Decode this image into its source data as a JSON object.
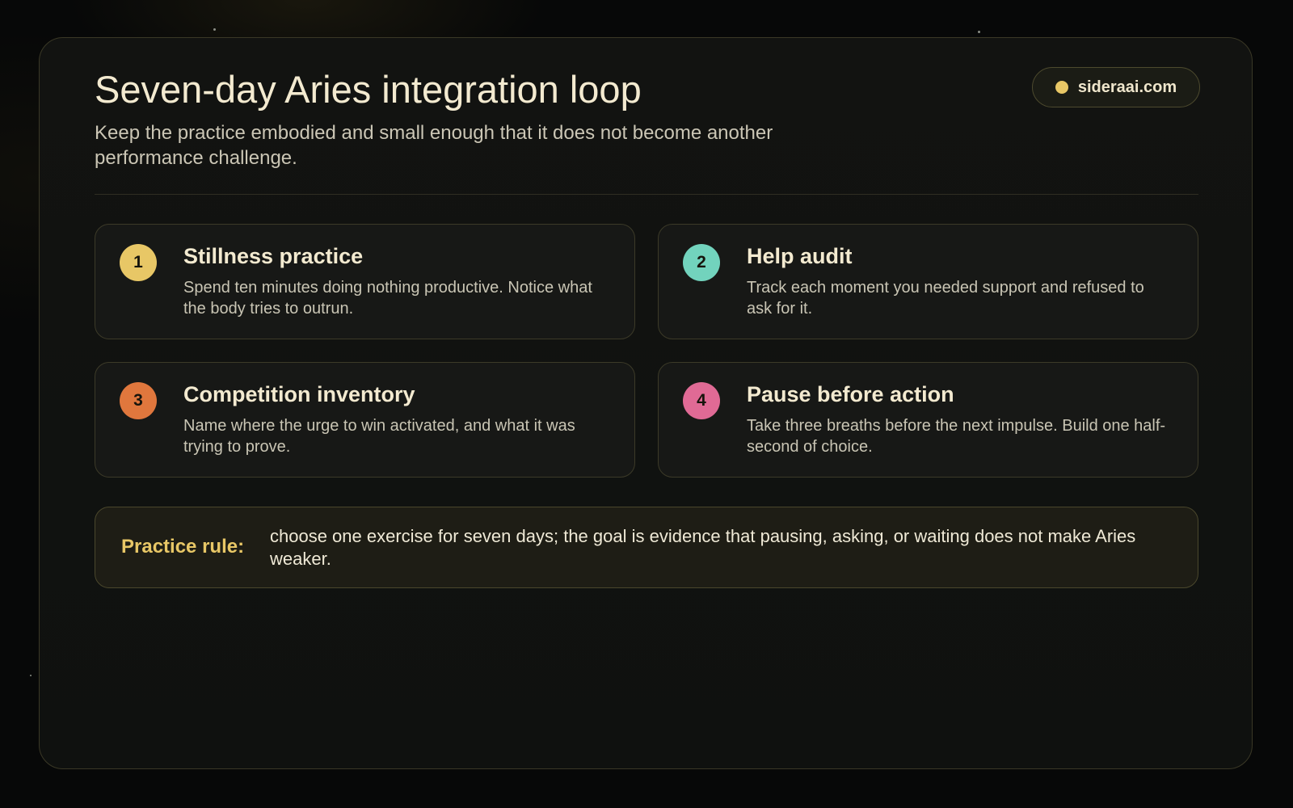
{
  "header": {
    "title": "Seven-day Aries integration loop",
    "subtitle": "Keep the practice embodied and small enough that it does not become another performance challenge."
  },
  "site_badge": {
    "label": "sideraai.com",
    "dot_color": "#e8c766"
  },
  "steps": [
    {
      "number": "1",
      "title": "Stillness practice",
      "description": "Spend ten minutes doing nothing productive. Notice what the body tries to outrun.",
      "color": "#e8c766"
    },
    {
      "number": "2",
      "title": "Help audit",
      "description": "Track each moment you needed support and refused to ask for it.",
      "color": "#72d3bd"
    },
    {
      "number": "3",
      "title": "Competition inventory",
      "description": "Name where the urge to win activated, and what it was trying to prove.",
      "color": "#e0773d"
    },
    {
      "number": "4",
      "title": "Pause before action",
      "description": "Take three breaths before the next impulse. Build one half-second of choice.",
      "color": "#e06a95"
    }
  ],
  "practice_rule": {
    "label": "Practice rule:",
    "text": "choose one exercise for seven days; the goal is evidence that pausing, asking, or waiting does not make Aries weaker."
  }
}
